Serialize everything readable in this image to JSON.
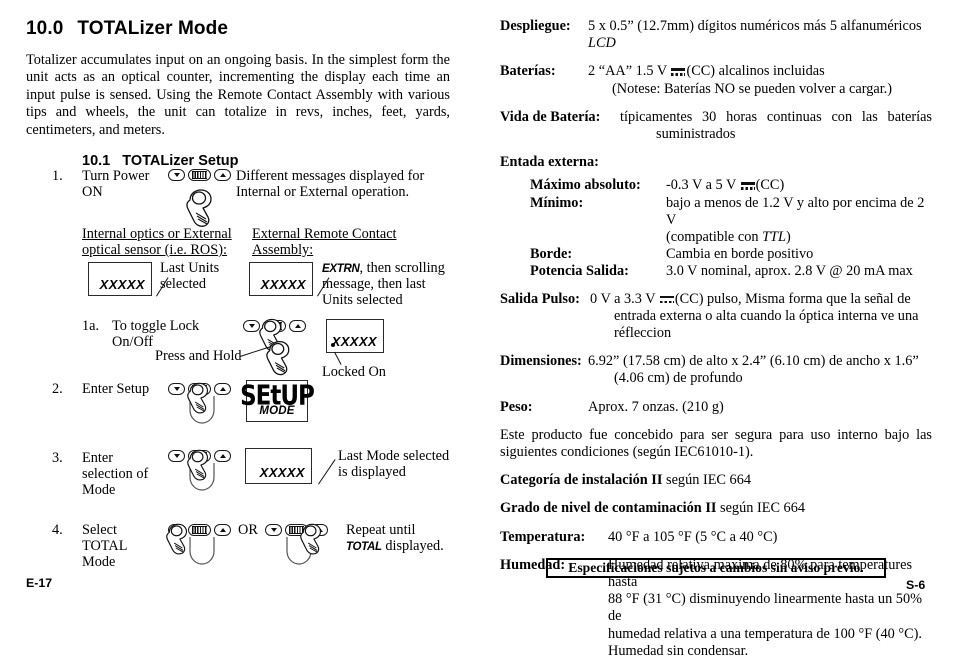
{
  "left_page": {
    "heading": {
      "number": "10.0",
      "title": "TOTALizer Mode"
    },
    "intro": "Totalizer accumulates input on an ongoing basis.  In the simplest form the unit acts as an optical counter, incrementing the display each time an input pulse is sensed.  Using the Remote Contact Assembly with various tips and wheels, the unit can totalize in revs, inches, feet, yards, centimeters, and meters.",
    "subheading": {
      "number": "10.1",
      "title": "TOTALizer Setup"
    },
    "steps": [
      {
        "number": "1.",
        "label_line1": "Turn Power",
        "label_line2": "ON",
        "note_line1": "Different messages displayed for",
        "note_line2": "Internal or External operation.",
        "left_case": {
          "head_line1": "Internal optics or External",
          "head_line2": "optical sensor (i.e. ROS):",
          "lcd_value": "XXXXX",
          "caption_line1": "Last Units",
          "caption_line2": "selected"
        },
        "right_case": {
          "head_line1": "External Remote Contact",
          "head_line2": "Assembly:",
          "lcd_value": "XXXXX",
          "caption_seg": "EXTRN",
          "caption_line1": ", then scrolling",
          "caption_line2": "message, then last",
          "caption_line3": "Units selected"
        }
      },
      {
        "number": "1a.",
        "label_line1": "To toggle Lock",
        "label_line2": "On/Off",
        "press_hold": "Press and Hold",
        "lcd_value": "XXXXX",
        "lcd_caption": "Locked On"
      },
      {
        "number": "2.",
        "label_line1": "Enter Setup",
        "display_big": "SEtUP",
        "display_small": "MODE"
      },
      {
        "number": "3.",
        "label_line1": "Enter",
        "label_line2": "selection of",
        "label_line3": "Mode",
        "lcd_value": "XXXXX",
        "note_line1": "Last Mode selected",
        "note_line2": "is displayed"
      },
      {
        "number": "4.",
        "label_line1": "Select",
        "label_line2": "TOTAL",
        "label_line3": "Mode",
        "or_label": "OR",
        "note_line1": "Repeat until",
        "note_seg": "TOTAL",
        "note_line2": " displayed."
      }
    ],
    "keys": {
      "down_icon": "triangle-down-icon",
      "center_icon": "mode-ridged-key-icon",
      "up_icon": "triangle-up-icon"
    },
    "folio": "E-17"
  },
  "right_page": {
    "specs": [
      {
        "key": "Despliegue:",
        "value_pre": "5 x 0.5” (12.7mm) dígitos numéricos más 5 alfanuméricos ",
        "value_italic": "LCD",
        "value_post": ""
      },
      {
        "key": "Baterías:",
        "line1_pre": "2 “AA” 1.5 V ",
        "line1_post": "(CC) alcalinos incluidas",
        "line2": "(Notese:  Baterías NO se pueden volver a cargar.)"
      },
      {
        "key": "Vida de Batería:",
        "line1": "típicamentes 30 horas continuas con las baterías",
        "line2": "suministrados"
      }
    ],
    "external_input": {
      "heading": "Entada externa:",
      "rows": [
        {
          "key": "Máximo absoluto:",
          "value_pre": "-0.3 V a 5 V ",
          "value_post": "(CC)"
        },
        {
          "key": "Mínimo:",
          "line1": "bajo a menos de 1.2 V y alto por encima de 2 V",
          "line2_pre": "(compatible con ",
          "line2_italic": "TTL",
          "line2_post": ")"
        },
        {
          "key": "Borde:",
          "value": "Cambia en borde positivo"
        },
        {
          "key": "Potencia  Salida:",
          "value": "3.0 V nominal, aprox. 2.8 V @ 20 mA max"
        }
      ]
    },
    "pulse_output": {
      "key": "Salida  Pulso:",
      "line1_pre": "0 V a 3.3 V ",
      "line1_post": "(CC) pulso, Misma forma que la señal de",
      "line2": "entrada externa o alta cuando la óptica interna ve una réfleccion"
    },
    "dimensions": {
      "key": "Dimensiones:",
      "line1": "6.92” (17.58 cm) de alto x 2.4” (6.10 cm) de ancho x 1.6”",
      "line2": "(4.06 cm) de profundo"
    },
    "weight": {
      "key": "Peso:",
      "value": "Aprox. 7 onzas. (210 g)"
    },
    "safety_paragraph": "Este producto fue concebido para ser segura para uso interno bajo las siguientes condiciones (según IEC61010-1).",
    "install_category": {
      "bold": "Categoría de instalación II",
      "rest": " según IEC 664"
    },
    "pollution_degree": {
      "bold": "Grado de nivel de contaminación II",
      "rest": "  según IEC 664"
    },
    "temperature": {
      "key": "Temperatura:",
      "value": "40 °F a 105 °F (5 °C a 40 °C)"
    },
    "humidity": {
      "key": "Humedad:",
      "line1": "Humedad relativa maxima de 80% para temperatures hasta",
      "line2": "88 °F (31 °C) disminuyendo linearmente hasta un 50% de",
      "line3": "humedad relativa a una temperatura de 100 °F (40 °C).",
      "line4": "Humedad sin condensar."
    },
    "notice": "Especificaciones sujetos a cambios sin aviso previo.",
    "folio": "S-6"
  }
}
